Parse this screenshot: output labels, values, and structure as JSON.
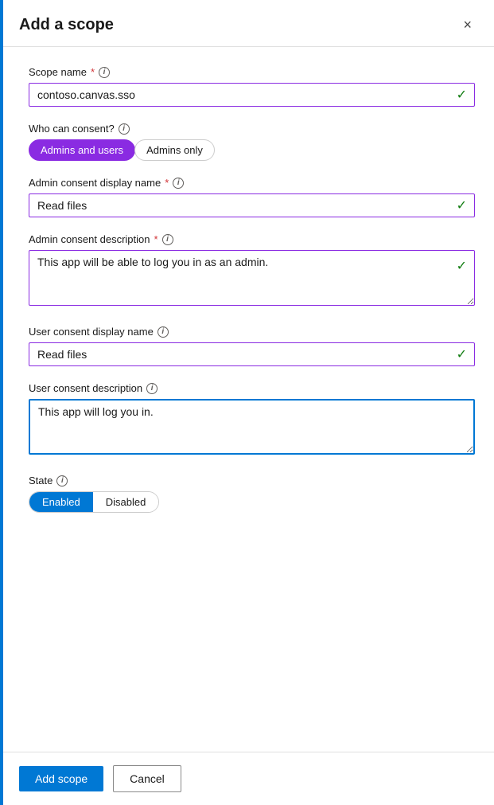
{
  "dialog": {
    "title": "Add a scope",
    "close_label": "×"
  },
  "fields": {
    "scope_name": {
      "label": "Scope name",
      "required": true,
      "value": "contoso.canvas.sso",
      "has_check": true
    },
    "who_can_consent": {
      "label": "Who can consent?",
      "options": [
        {
          "id": "admins-users",
          "label": "Admins and users",
          "active": true
        },
        {
          "id": "admins-only",
          "label": "Admins only",
          "active": false
        }
      ]
    },
    "admin_consent_display_name": {
      "label": "Admin consent display name",
      "required": true,
      "value": "Read files",
      "has_check": true
    },
    "admin_consent_description": {
      "label": "Admin consent description",
      "required": true,
      "value": "This app will be able to log you in as an admin.",
      "has_check": true
    },
    "user_consent_display_name": {
      "label": "User consent display name",
      "required": false,
      "value": "Read files",
      "has_check": true
    },
    "user_consent_description": {
      "label": "User consent description",
      "required": false,
      "value": "This app will log you in."
    },
    "state": {
      "label": "State",
      "options": [
        {
          "id": "enabled",
          "label": "Enabled",
          "active": true
        },
        {
          "id": "disabled",
          "label": "Disabled",
          "active": false
        }
      ]
    }
  },
  "footer": {
    "add_scope_label": "Add scope",
    "cancel_label": "Cancel"
  },
  "info_icon_label": "i"
}
